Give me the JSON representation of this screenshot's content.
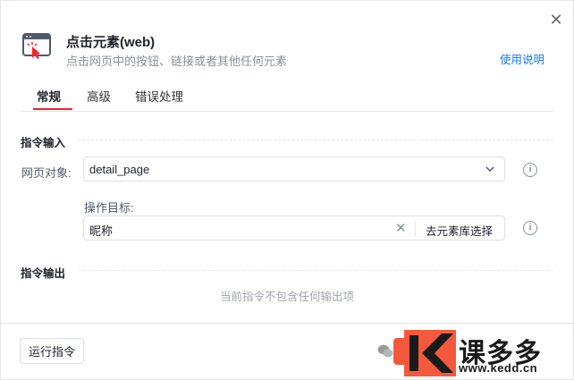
{
  "dialog": {
    "title": "点击元素(web)",
    "subtitle": "点击网页中的按钮、链接或者其他任何元素",
    "help_link": "使用说明",
    "close_icon": "close-icon"
  },
  "tabs": [
    {
      "label": "常规",
      "active": true
    },
    {
      "label": "高级",
      "active": false
    },
    {
      "label": "错误处理",
      "active": false
    }
  ],
  "input_section": {
    "title": "指令输入",
    "page_object": {
      "label": "网页对象:",
      "value": "detail_page"
    },
    "target": {
      "label": "操作目标:",
      "value": "昵称",
      "pick_button": "去元素库选择"
    }
  },
  "output_section": {
    "title": "指令输出",
    "empty_text": "当前指令不包含任何输出项"
  },
  "footer": {
    "run_button": "运行指令"
  },
  "watermark": {
    "brand": "课多多",
    "url": "www.kedd.cn"
  },
  "colors": {
    "accent": "#f5222d",
    "link": "#1677ff",
    "primary_button": "#f5593d"
  }
}
